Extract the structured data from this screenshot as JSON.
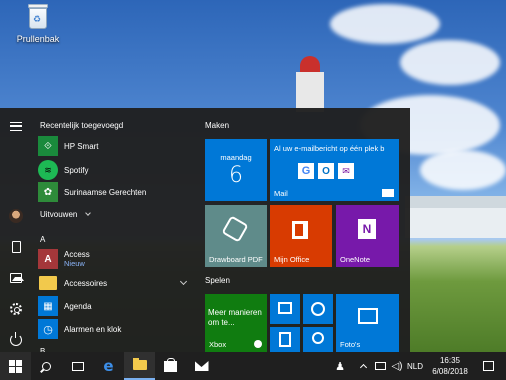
{
  "desktop": {
    "recycle_bin_label": "Prullenbak"
  },
  "start_menu": {
    "recently_added_title": "Recentelijk toegevoegd",
    "recent_apps": [
      {
        "name": "HP Smart",
        "icon": "hp-smart-icon",
        "color": "#1a8a3c"
      },
      {
        "name": "Spotify",
        "icon": "spotify-icon",
        "color": "#1db954"
      },
      {
        "name": "Surinaamse Gerechten",
        "icon": "recipe-icon",
        "color": "#2e8b3a"
      }
    ],
    "expand_label": "Uitvouwen",
    "letter_a": "A",
    "apps_a": [
      {
        "name": "Access",
        "sub": "Nieuw",
        "icon": "access-icon",
        "color": "#a4373a"
      },
      {
        "name": "Accessoires",
        "sub": "",
        "icon": "folder-icon",
        "color": "#f2c94c"
      },
      {
        "name": "Agenda",
        "sub": "",
        "icon": "calendar-icon",
        "color": "#0078d7"
      },
      {
        "name": "Alarmen en klok",
        "sub": "",
        "icon": "alarm-icon",
        "color": "#0078d7"
      }
    ],
    "letter_b": "B"
  },
  "tiles": {
    "group_make": "Maken",
    "group_play": "Spelen",
    "calendar_day": "maandag",
    "calendar_date": "6",
    "mail_header": "Al uw e-mailbericht op één plek b",
    "mail_label": "Mail",
    "drawboard_label": "Drawboard PDF",
    "office_label": "Mijn Office",
    "onenote_label": "OneNote",
    "xbox_promo": "Meer manieren om te...",
    "xbox_label": "Xbox",
    "photos_label": "Foto's"
  },
  "taskbar": {
    "language": "NLD",
    "time": "16:35",
    "date": "6/08/2018"
  },
  "colors": {
    "accent": "#0078d7",
    "start_bg": "#202020",
    "taskbar_bg": "#1f1f1f",
    "tile_drawboard": "#5f8b8a",
    "tile_office": "#d83b01",
    "tile_onenote": "#7719aa",
    "tile_xbox": "#107c10"
  }
}
